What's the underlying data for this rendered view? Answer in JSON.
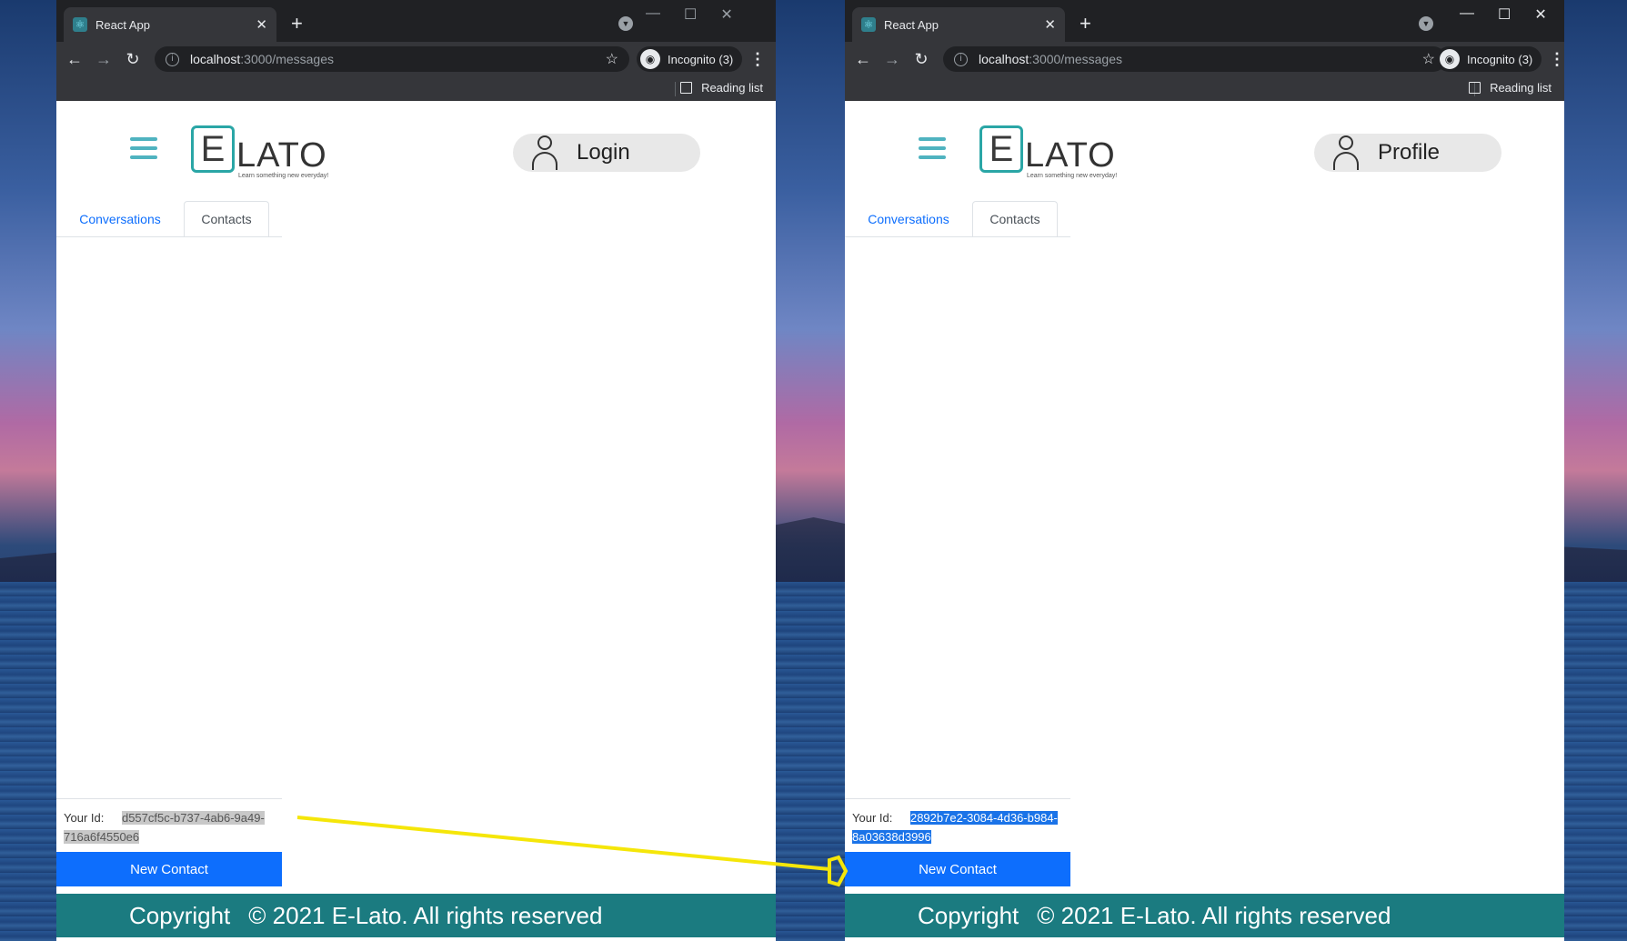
{
  "browser": {
    "tab_title": "React App",
    "url_host": "localhost",
    "url_path": ":3000/messages",
    "incognito_label": "Incognito (3)",
    "reading_list": "Reading list"
  },
  "app": {
    "logo_text": "LATO",
    "logo_letter": "E",
    "logo_tagline": "Learn something new everyday!",
    "tabs": [
      "Conversations",
      "Contacts"
    ],
    "your_id_label": "Your Id:",
    "new_contact": "New Contact",
    "footer_copyright": "Copyright",
    "footer_text": "© 2021 E-Lato. All rights reserved",
    "accent_color": "#0d6efd",
    "footer_color": "#1b7b80"
  },
  "windows": [
    {
      "auth_label": "Login",
      "your_id": "d557cf5c-b737-4ab6-9a49-716a6f4550e6",
      "id_highlight": "grey"
    },
    {
      "auth_label": "Profile",
      "your_id": "2892b7e2-3084-4d36-b984-8a03638d3996",
      "id_highlight": "blue"
    }
  ]
}
